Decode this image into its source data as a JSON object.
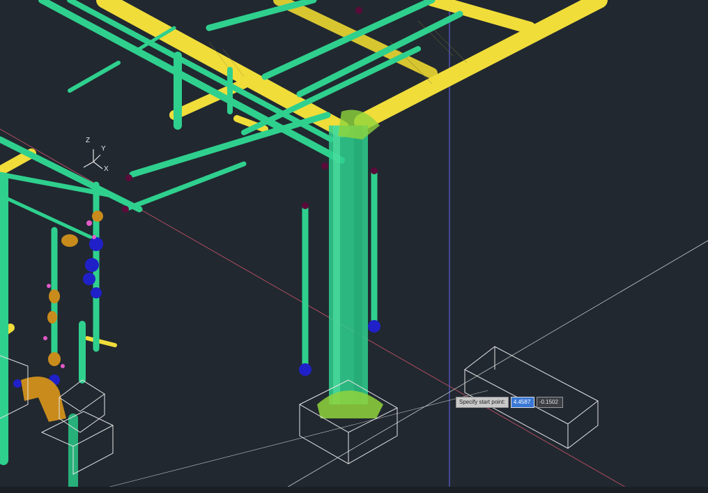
{
  "viewport": {
    "background": "#212830",
    "ucs_icon": {
      "z_label": "Z",
      "y_label": "Y",
      "x_label": "X"
    }
  },
  "colors": {
    "pipe_green": "#2fd08e",
    "beam_yellow": "#f0dd3a",
    "fitting_blue": "#2020c8",
    "valve_orange": "#c98c1c",
    "wireframe_white": "#e6e6e6",
    "crosshair_blue": "#5a5fd6",
    "axis_red": "#c05a6a"
  },
  "dynamic_input": {
    "prompt": "Specify start point:",
    "x_value": "4.4587",
    "y_value": "-0.1502"
  }
}
